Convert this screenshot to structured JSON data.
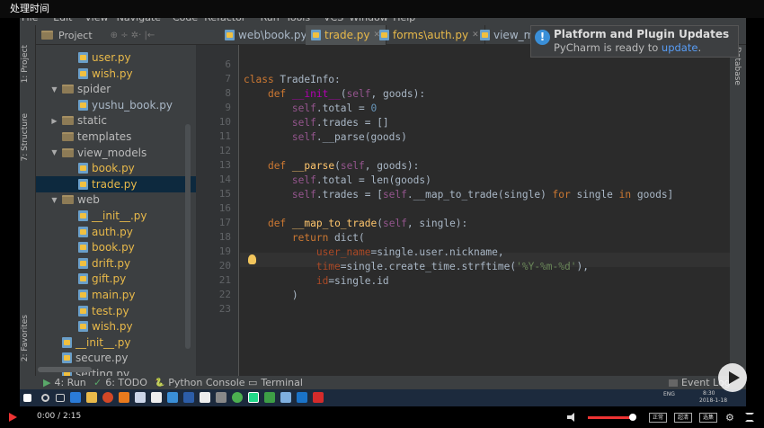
{
  "video_title": "处理时间",
  "menu": [
    "File",
    "Edit",
    "View",
    "Navigate",
    "Code",
    "Refactor",
    "Run",
    "Tools",
    "VCS",
    "Window",
    "Help"
  ],
  "project_header": {
    "label": "Project",
    "icons": "⊕ ÷ ✲· |←"
  },
  "editor_tabs": [
    {
      "label": "web\\book.py",
      "active": false
    },
    {
      "label": "trade.py",
      "active": true
    },
    {
      "label": "forms\\auth.py",
      "active": false
    },
    {
      "label": "view_model",
      "active": false
    }
  ],
  "left_strip": {
    "project": "1: Project",
    "structure": "7: Structure",
    "favorites": "2: Favorites"
  },
  "tree": [
    {
      "label": "user.py",
      "type": "file",
      "indent": 2,
      "color": "#e8b94a"
    },
    {
      "label": "wish.py",
      "type": "file",
      "indent": 2,
      "color": "#e8b94a"
    },
    {
      "label": "spider",
      "type": "folder",
      "indent": 1,
      "arrow": "▼",
      "color": "#bbbbbb"
    },
    {
      "label": "yushu_book.py",
      "type": "file",
      "indent": 2,
      "color": "#a9b7c6"
    },
    {
      "label": "static",
      "type": "folder",
      "indent": 1,
      "arrow": "▶",
      "color": "#bbbbbb"
    },
    {
      "label": "templates",
      "type": "folder",
      "indent": 1,
      "arrow": "",
      "color": "#bbbbbb"
    },
    {
      "label": "view_models",
      "type": "folder",
      "indent": 1,
      "arrow": "▼",
      "color": "#bbbbbb"
    },
    {
      "label": "book.py",
      "type": "file",
      "indent": 2,
      "color": "#e8b94a"
    },
    {
      "label": "trade.py",
      "type": "file",
      "indent": 2,
      "color": "#e8b94a",
      "selected": true
    },
    {
      "label": "web",
      "type": "folder",
      "indent": 1,
      "arrow": "▼",
      "color": "#bbbbbb"
    },
    {
      "label": "__init__.py",
      "type": "file",
      "indent": 2,
      "color": "#e8b94a"
    },
    {
      "label": "auth.py",
      "type": "file",
      "indent": 2,
      "color": "#e8b94a"
    },
    {
      "label": "book.py",
      "type": "file",
      "indent": 2,
      "color": "#e8b94a"
    },
    {
      "label": "drift.py",
      "type": "file",
      "indent": 2,
      "color": "#e8b94a"
    },
    {
      "label": "gift.py",
      "type": "file",
      "indent": 2,
      "color": "#e8b94a"
    },
    {
      "label": "main.py",
      "type": "file",
      "indent": 2,
      "color": "#e8b94a"
    },
    {
      "label": "test.py",
      "type": "file",
      "indent": 2,
      "color": "#e8b94a"
    },
    {
      "label": "wish.py",
      "type": "file",
      "indent": 2,
      "color": "#e8b94a"
    },
    {
      "label": "__init__.py",
      "type": "file",
      "indent": 1,
      "color": "#e8b94a"
    },
    {
      "label": "secure.py",
      "type": "file",
      "indent": 1,
      "color": "#bbbbbb"
    },
    {
      "label": "setting.py",
      "type": "file",
      "indent": 1,
      "color": "#bbbbbb"
    }
  ],
  "line_numbers": [
    "6",
    "7",
    "8",
    "9",
    "10",
    "11",
    "12",
    "13",
    "14",
    "15",
    "16",
    "17",
    "18",
    "19",
    "20",
    "21",
    "22",
    "23"
  ],
  "code_lines": [
    "",
    "<span class='kw'>class</span> TradeInfo:",
    "    <span class='kw'>def</span> <span class='dn'>__init__</span>(<span class='sf'>self</span>, goods):",
    "        <span class='sf'>self</span>.total = <span class='nm'>0</span>",
    "        <span class='sf'>self</span>.trades = []",
    "        <span class='sf'>self</span>.__parse(goods)",
    "",
    "    <span class='kw'>def</span> <span class='fn'>__parse</span>(<span class='sf'>self</span>, goods):",
    "        <span class='sf'>self</span>.total = len(goods)",
    "        <span class='sf'>self</span>.trades = [<span class='sf'>self</span>.__map_to_trade(single) <span class='kw'>for</span> single <span class='kw'>in</span> goods]",
    "",
    "    <span class='kw'>def</span> <span class='fn'>__map_to_trade</span>(<span class='sf'>self</span>, single):",
    "        <span class='kw'>return</span> dict(",
    "            <span class='pm'>user_name</span>=single.user.nickname,",
    "            <span class='pm'>time</span>=single.create_time.strftime(<span class='st'>'%Y-%m-%d'</span>),",
    "            <span class='pm'>id</span>=single.id",
    "        )",
    ""
  ],
  "notification": {
    "title": "Platform and Plugin Updates",
    "text": "PyCharm is ready to ",
    "link": "update",
    "suffix": ".",
    "icon": "!"
  },
  "right_strip_label": "Database",
  "bottom_tabs": [
    {
      "label": "4: Run",
      "icon": "▶"
    },
    {
      "label": "6: TODO",
      "icon": "✓"
    },
    {
      "label": "Python Console",
      "icon": "🐍"
    },
    {
      "label": "Terminal",
      "icon": "▭"
    }
  ],
  "event_log": "Event Log",
  "tray": {
    "lang": "ENG",
    "time": "8:30",
    "date": "2018-1-18"
  },
  "player": {
    "time": "0:00 / 2:15",
    "btn1": "正常",
    "btn2": "超清",
    "btn3": "选集"
  }
}
